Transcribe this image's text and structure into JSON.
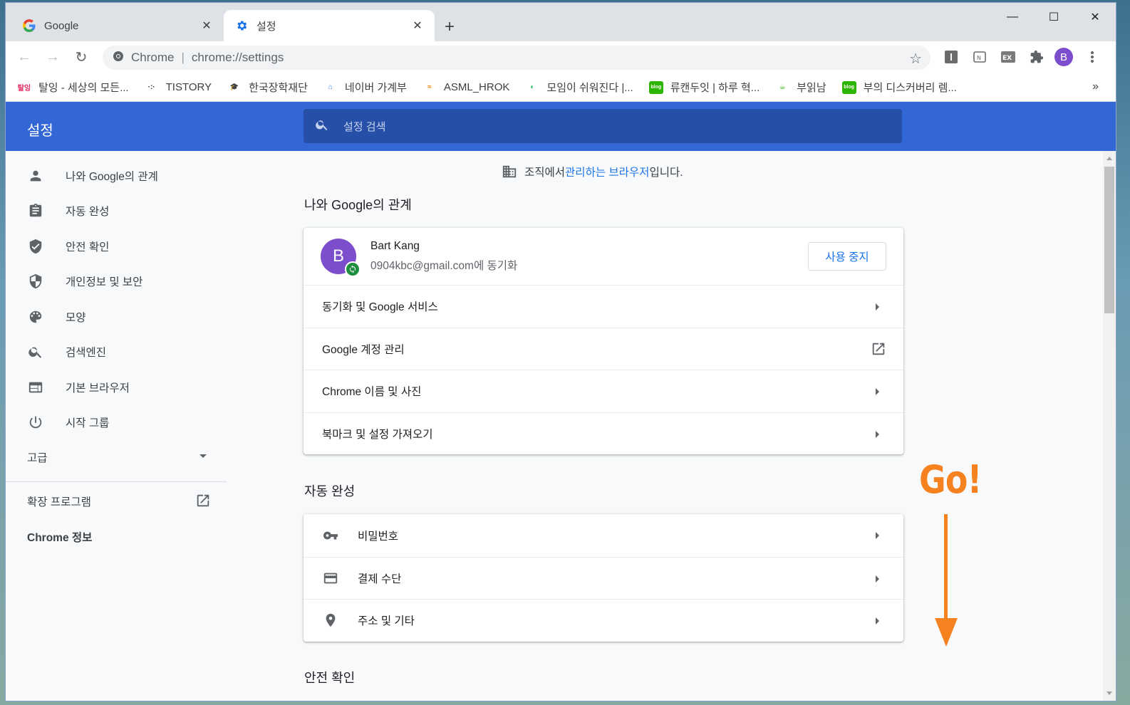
{
  "tabs": [
    {
      "title": "Google",
      "active": false,
      "icon": "google-g-icon"
    },
    {
      "title": "설정",
      "active": true,
      "icon": "gear-icon"
    }
  ],
  "omnibox": {
    "site": "Chrome",
    "separator": "|",
    "url": "chrome://settings"
  },
  "profile_initial": "B",
  "bookmarks": [
    {
      "label": "탈잉 - 세상의 모든...",
      "icon_text": "탈잉",
      "icon_color": "#e5245e"
    },
    {
      "label": "TISTORY",
      "icon_text": "·:·",
      "icon_color": "#222222"
    },
    {
      "label": "한국장학재단",
      "icon_text": "🎓",
      "icon_color": "#1b4c9c"
    },
    {
      "label": "네이버 가계부",
      "icon_text": "⌂",
      "icon_color": "#2f7de1"
    },
    {
      "label": "ASML_HROK",
      "icon_text": "≈",
      "icon_color": "#f08200"
    },
    {
      "label": "모임이 쉬워진다 |...",
      "icon_text": "◐",
      "icon_color": "#1fb956"
    },
    {
      "label": "류캔두잇 | 하루 혁...",
      "icon_text": "blog",
      "icon_color": "#2db400"
    },
    {
      "label": "부읽남",
      "icon_text": "☕",
      "icon_color": "#2db400"
    },
    {
      "label": "부의 디스커버리 렘...",
      "icon_text": "blog",
      "icon_color": "#2db400"
    }
  ],
  "bookmarks_more": "»",
  "header": {
    "title": "설정",
    "search_placeholder": "설정 검색"
  },
  "sidebar": {
    "items": [
      {
        "label": "나와 Google의 관계",
        "icon": "person-icon"
      },
      {
        "label": "자동 완성",
        "icon": "clipboard-icon"
      },
      {
        "label": "안전 확인",
        "icon": "shield-check-icon"
      },
      {
        "label": "개인정보 및 보안",
        "icon": "shield-half-icon"
      },
      {
        "label": "모양",
        "icon": "palette-icon"
      },
      {
        "label": "검색엔진",
        "icon": "search-icon"
      },
      {
        "label": "기본 브라우저",
        "icon": "browser-icon"
      },
      {
        "label": "시작 그룹",
        "icon": "power-icon"
      }
    ],
    "advanced": "고급",
    "extensions": "확장 프로그램",
    "about": "Chrome 정보"
  },
  "managed": {
    "prefix": "조직에서 ",
    "link": "관리하는 브라우저",
    "suffix": "입니다."
  },
  "sections": {
    "you_and_google": {
      "title": "나와 Google의 관계",
      "profile": {
        "initial": "B",
        "name": "Bart Kang",
        "email": "0904kbc@gmail.com에 동기화",
        "button": "사용 중지"
      },
      "rows": [
        "동기화 및 Google 서비스",
        "Google 계정 관리",
        "Chrome 이름 및 사진",
        "북마크 및 설정 가져오기"
      ]
    },
    "autofill": {
      "title": "자동 완성",
      "rows": [
        {
          "label": "비밀번호",
          "icon": "key-icon"
        },
        {
          "label": "결제 수단",
          "icon": "credit-card-icon"
        },
        {
          "label": "주소 및 기타",
          "icon": "location-pin-icon"
        }
      ]
    },
    "safety": {
      "title": "안전 확인"
    }
  },
  "annotation": {
    "text": "Go!",
    "color": "#f5821f"
  },
  "colors": {
    "header_blue": "#3367d6",
    "search_blue": "#264fa8",
    "link_blue": "#1a73e8",
    "avatar_purple": "#7c4dcc"
  }
}
